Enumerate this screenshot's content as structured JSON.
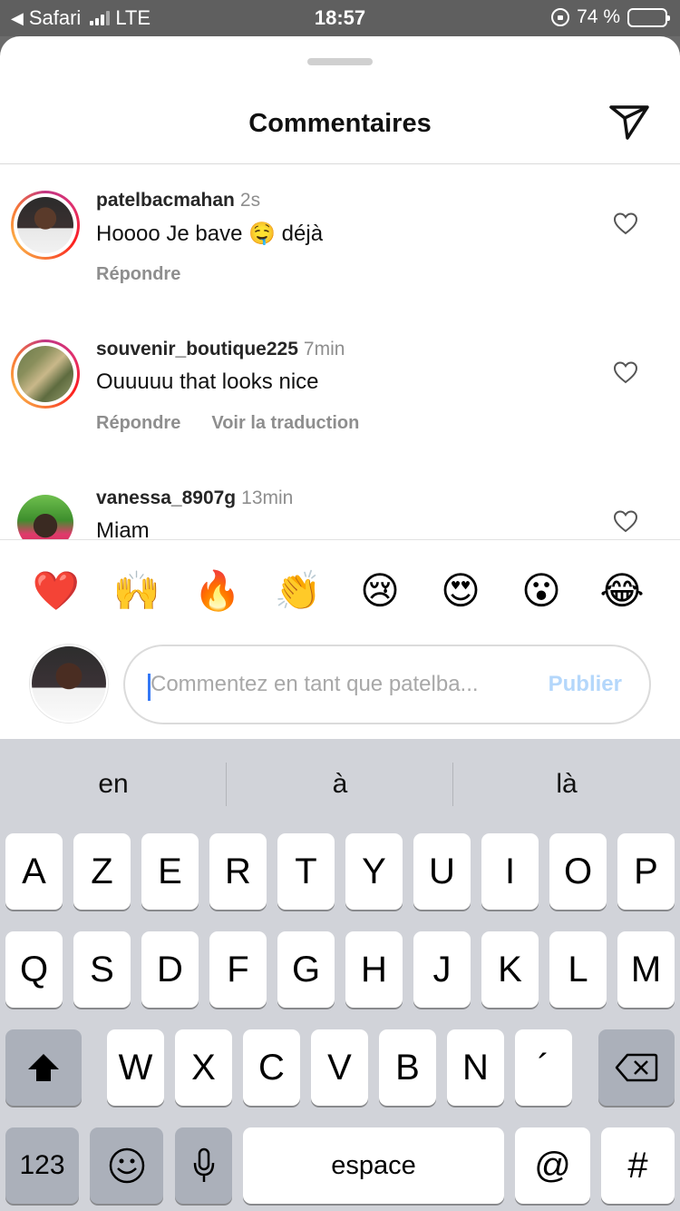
{
  "status_bar": {
    "back_app": "Safari",
    "carrier": "LTE",
    "time": "18:57",
    "battery_percent": "74 %",
    "battery_level": 0.74,
    "battery_color": "#f5d130"
  },
  "sheet": {
    "title": "Commentaires"
  },
  "comments": [
    {
      "username": "patelbacmahan",
      "time": "2s",
      "text": "Hoooo Je bave 🤤 déjà",
      "actions": [
        "Répondre"
      ]
    },
    {
      "username": "souvenir_boutique225",
      "time": "7min",
      "text": "Ouuuuu that looks nice",
      "actions": [
        "Répondre",
        "Voir la traduction"
      ]
    },
    {
      "username": "vanessa_8907g",
      "time": "13min",
      "text": "Miam",
      "actions": []
    }
  ],
  "emoji_reactions": [
    "❤️",
    "🙌",
    "🔥",
    "👏",
    "😢",
    "😍",
    "😮",
    "😂"
  ],
  "composer": {
    "placeholder": "Commentez en tant que patelba...",
    "publish_label": "Publier",
    "publish_color": "#b4d7fb"
  },
  "keyboard": {
    "suggestions": [
      "en",
      "à",
      "là"
    ],
    "row1": [
      "A",
      "Z",
      "E",
      "R",
      "T",
      "Y",
      "U",
      "I",
      "O",
      "P"
    ],
    "row2": [
      "Q",
      "S",
      "D",
      "F",
      "G",
      "H",
      "J",
      "K",
      "L",
      "M"
    ],
    "row3": [
      "W",
      "X",
      "C",
      "V",
      "B",
      "N",
      "´"
    ],
    "numbers_key": "123",
    "space_key": "espace",
    "at_key": "@",
    "hash_key": "#"
  }
}
